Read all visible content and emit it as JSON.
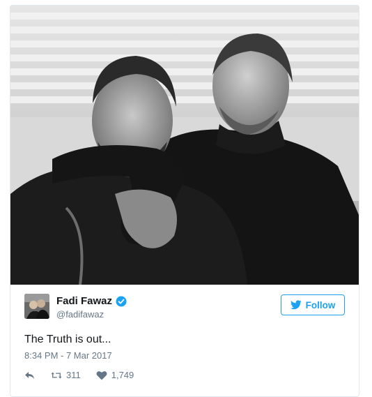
{
  "tweet": {
    "author": {
      "name": "Fadi Fawaz",
      "handle": "@fadifawaz",
      "verified_icon": "verified-badge-icon"
    },
    "follow_label": "Follow",
    "text": "The Truth is out...",
    "timestamp": "8:34 PM - 7 Mar 2017",
    "actions": {
      "reply_icon": "reply-icon",
      "retweets": "311",
      "likes": "1,749"
    }
  },
  "colors": {
    "accent": "#1da1f2",
    "muted": "#657786",
    "text": "#14171a",
    "border": "#e1e8ed"
  }
}
